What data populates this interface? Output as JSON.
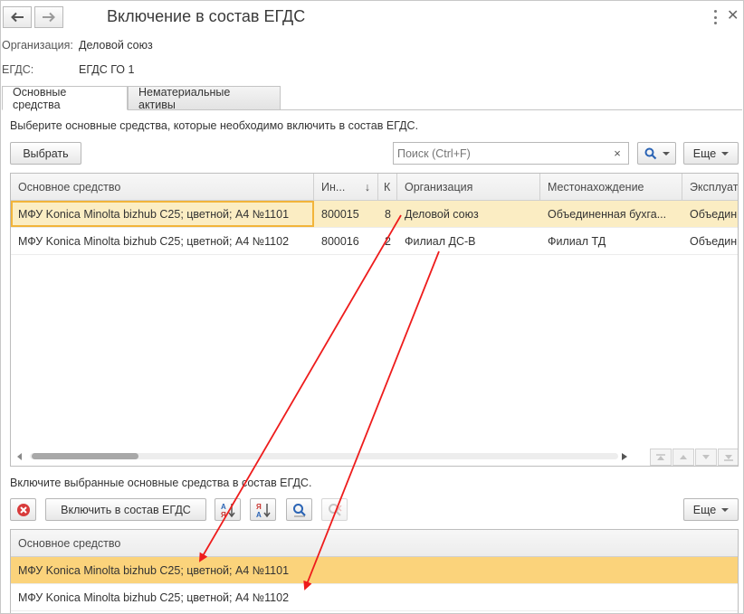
{
  "window": {
    "title": "Включение в состав ЕГДС"
  },
  "fields": {
    "organization_label": "Организация:",
    "organization_value": "Деловой союз",
    "egds_label": "ЕГДС:",
    "egds_value": "ЕГДС ГО 1"
  },
  "tabs": [
    {
      "label": "Основные средства",
      "active": true
    },
    {
      "label": "Нематериальные активы",
      "active": false
    }
  ],
  "top_section": {
    "instruction": "Выберите основные средства, которые необходимо включить в состав ЕГДС.",
    "select_button": "Выбрать",
    "search_placeholder": "Поиск (Ctrl+F)",
    "search_clear": "×",
    "more_button": "Еще",
    "columns": [
      "Основное средство",
      "Ин...",
      "К",
      "Организация",
      "Местонахождение",
      "Эксплуат"
    ],
    "sort_indicator": "↓",
    "rows": [
      {
        "asset": "МФУ Konica Minolta bizhub C25; цветной; A4  №1101",
        "inv": "800015",
        "k": "8",
        "org": "Деловой союз",
        "location": "Объединенная бухга...",
        "exploit": "Объедин"
      },
      {
        "asset": "МФУ Konica Minolta bizhub C25; цветной; A4  №1102",
        "inv": "800016",
        "k": "2",
        "org": "Филиал ДС-В",
        "location": "Филиал ТД",
        "exploit": "Объедин"
      }
    ]
  },
  "bottom_section": {
    "instruction": "Включите выбранные основные средства в состав ЕГДС.",
    "include_button": "Включить в состав ЕГДС",
    "more_button": "Еще",
    "column": "Основное средство",
    "rows": [
      {
        "asset": "МФУ Konica Minolta bizhub C25; цветной; A4  №1101"
      },
      {
        "asset": "МФУ Konica Minolta bizhub C25; цветной; A4  №1102"
      }
    ]
  },
  "colors": {
    "selected_row": "#fbedc3",
    "selected_row_bottom": "#fbd37b",
    "focus_border": "#f2b43a",
    "arrow": "#ee1c1c",
    "delete_red": "#d83b3b",
    "sort_blue": "#2b64b5",
    "sort_red": "#c9342f"
  }
}
